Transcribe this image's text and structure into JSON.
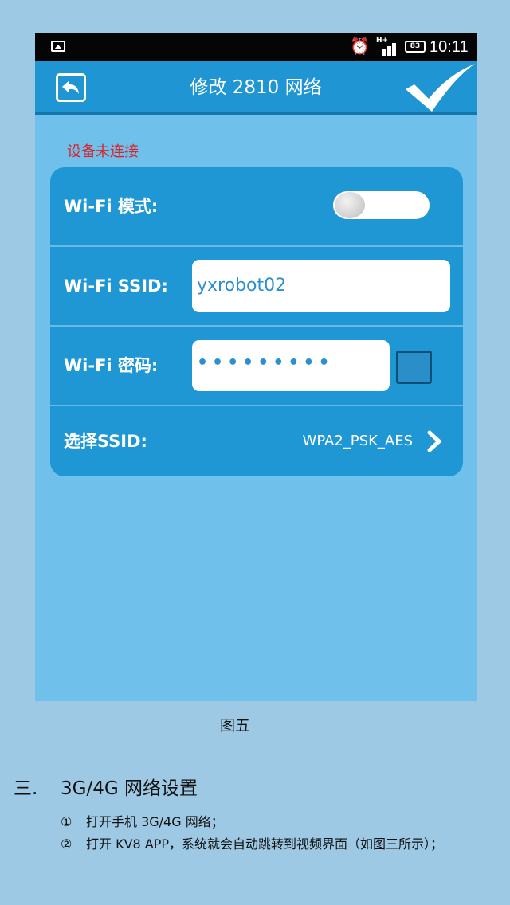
{
  "status_bar": {
    "battery": "83",
    "time": "10:11",
    "network": "H+"
  },
  "header": {
    "title": "修改 2810  网络"
  },
  "status_message": "设备未连接",
  "form": {
    "wifi_mode_label": "Wi-Fi 模式:",
    "wifi_mode_on": false,
    "ssid_label": "Wi-Fi SSID:",
    "ssid_value": "yxrobot02",
    "password_label": "Wi-Fi 密码:",
    "password_mask": "•••••••••",
    "select_ssid_label": "选择SSID:",
    "security_value": "WPA2_PSK_AES"
  },
  "document": {
    "caption": "图五",
    "section_number": "三.",
    "section_title": "3G/4G 网络设置",
    "steps": [
      {
        "marker": "①",
        "text": "打开手机 3G/4G 网络；"
      },
      {
        "marker": "②",
        "text": "打开 KV8 APP，系统就会自动跳转到视频界面（如图三所示）；"
      }
    ]
  }
}
